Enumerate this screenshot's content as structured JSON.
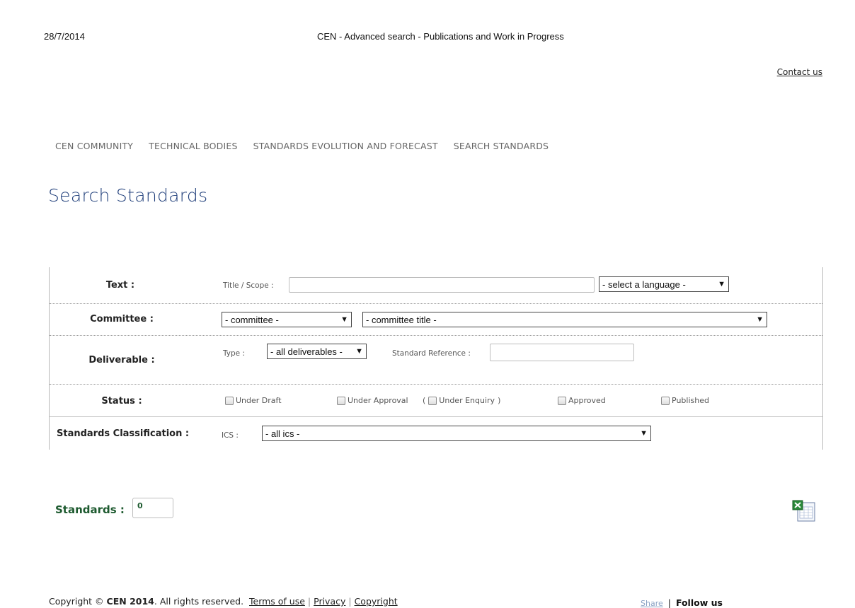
{
  "print_header": {
    "date": "28/7/2014",
    "title": "CEN - Advanced search - Publications and Work in Progress"
  },
  "header": {
    "contact_label": "Contact us"
  },
  "nav": {
    "items": [
      "CEN COMMUNITY",
      "TECHNICAL BODIES",
      "STANDARDS EVOLUTION AND FORECAST",
      "SEARCH STANDARDS"
    ]
  },
  "page_title": "Search Standards",
  "form": {
    "text_row": {
      "label": "Text :",
      "title_scope_label": "Title / Scope :",
      "title_scope_value": "",
      "language_select": "- select a language -"
    },
    "committee_row": {
      "label": "Committee :",
      "committee_select": "- committee -",
      "committee_title_select": "- committee title -"
    },
    "deliverable_row": {
      "label": "Deliverable :",
      "type_label": "Type :",
      "type_select": "- all deliverables -",
      "reference_label": "Standard Reference :",
      "reference_value": ""
    },
    "status_row": {
      "label": "Status :",
      "options": {
        "under_draft": "Under Draft",
        "under_approval": "Under Approval",
        "paren_open": "(",
        "under_enquiry": "Under Enquiry",
        "paren_close": ")",
        "approved": "Approved",
        "published": "Published"
      }
    },
    "classification_row": {
      "label": "Standards Classification :",
      "ics_label": "ICS :",
      "ics_select": "- all ics -"
    }
  },
  "results": {
    "label": "Standards :",
    "count": "0",
    "export_icon": "excel-icon"
  },
  "footer": {
    "copyright_prefix": "Copyright ©",
    "org_year": "CEN 2014",
    "rights": ". All rights reserved.",
    "terms": "Terms of use",
    "privacy": "Privacy",
    "copyright_link": "Copyright",
    "separator": "|",
    "share": "Share",
    "follow": "Follow us"
  },
  "colors": {
    "heading_blue": "#1f3e7a",
    "standards_green": "#1d5a2f",
    "nav_gray": "#666666"
  }
}
